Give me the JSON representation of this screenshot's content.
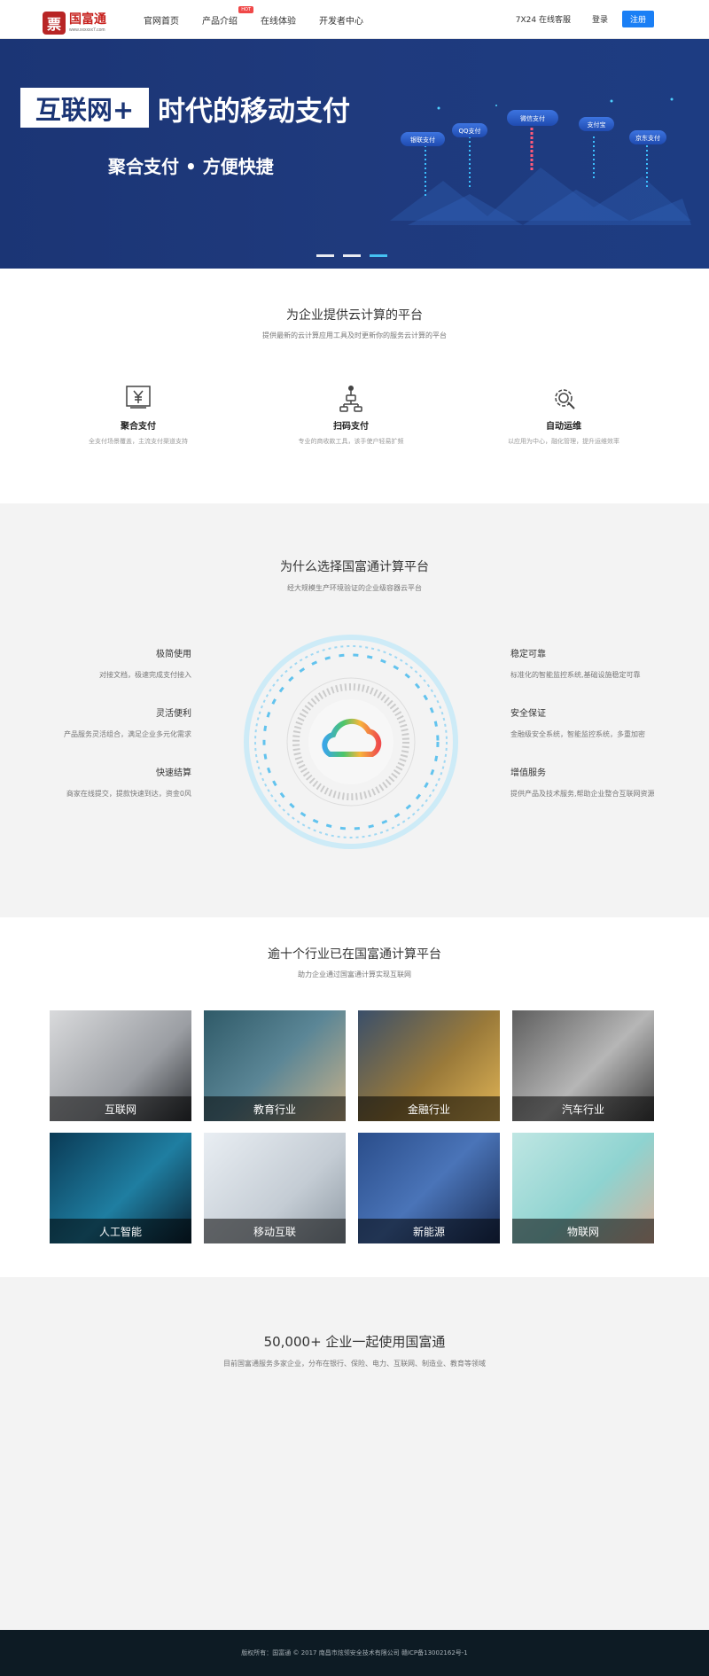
{
  "header": {
    "logo_cn": "国富通",
    "logo_url": "www.xxxxxx7.com",
    "nav": [
      "官网首页",
      "产品介绍",
      "在线体验",
      "开发者中心"
    ],
    "nav_badge": "HOT",
    "service": "7X24 在线客服",
    "login": "登录",
    "register": "注册"
  },
  "banner": {
    "box_text": "互联网+",
    "title_rest": "时代的移动支付",
    "subtitle": "聚合支付 • 方便快捷",
    "bubbles": [
      "微信支付",
      "QQ支付",
      "银联支付",
      "支付宝",
      "京东支付"
    ]
  },
  "section1": {
    "title": "为企业提供云计算的平台",
    "subtitle": "提供最新的云计算应用工具及时更新你的服务云计算的平台",
    "features": [
      {
        "title": "聚合支付",
        "desc": "全支付场景覆盖，主流支付渠道支持",
        "icon": "yuan-icon"
      },
      {
        "title": "扫码支付",
        "desc": "专业的商收款工具，该手使户轻易扩频",
        "icon": "network-icon"
      },
      {
        "title": "自动运维",
        "desc": "以应用为中心，融化管理，提升运维效率",
        "icon": "gear-icon"
      }
    ]
  },
  "section2": {
    "title": "为什么选择国富通计算平台",
    "subtitle": "经大规模生产环境验证的企业级容器云平台",
    "left": [
      {
        "title": "极简使用",
        "desc": "对接文档，极速完成支付接入"
      },
      {
        "title": "灵活便利",
        "desc": "产品服务灵活组合，满足企业多元化需求"
      },
      {
        "title": "快速结算",
        "desc": "商家在线提交，提款快速到达，资金0风"
      }
    ],
    "right": [
      {
        "title": "稳定可靠",
        "desc": "标准化的智能监控系统,基础设施稳定可靠"
      },
      {
        "title": "安全保证",
        "desc": "金融级安全系统，智能监控系统，多重加密"
      },
      {
        "title": "增值服务",
        "desc": "提供产品及技术服务,帮助企业整合互联网资源"
      }
    ]
  },
  "section3": {
    "title": "逾十个行业已在国富通计算平台",
    "subtitle": "助力企业通过国富通计算实现互联网",
    "industries": [
      "互联网",
      "教育行业",
      "金融行业",
      "汽车行业",
      "人工智能",
      "移动互联",
      "新能源",
      "物联网"
    ]
  },
  "section4": {
    "title": "50,000+ 企业一起使用国富通",
    "subtitle": "目前国富通服务多家企业，分布在银行、保险、电力、互联网、制造业、教育等领域"
  },
  "footer": {
    "text": "版权所有：国富通 © 2017 南昌市炫领安全技术有限公司 赣ICP备13002162号-1"
  }
}
